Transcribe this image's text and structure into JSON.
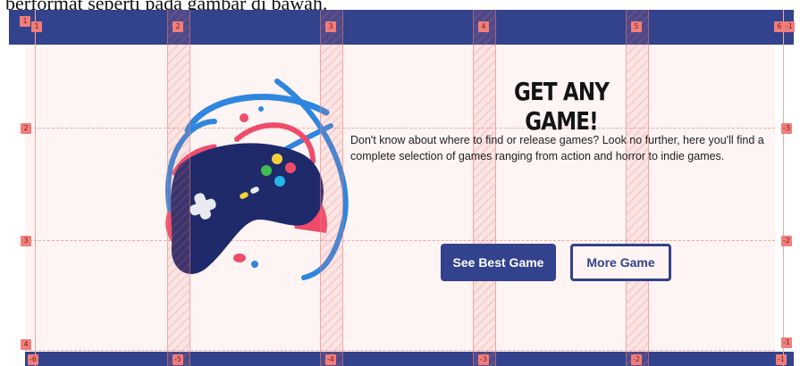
{
  "caption": "berformat seperti pada gambar di bawah.",
  "hero": {
    "title": "GET ANY GAME!",
    "description": "Don't know about where to find or release games? Look no further, here you'll find a complete selection of games ranging from action and horror to indie games.",
    "primary_button": "See Best Game",
    "secondary_button": "More Game"
  },
  "grid": {
    "top_markers": [
      "1",
      "1",
      "2",
      "3",
      "4",
      "5",
      "6",
      "-1"
    ],
    "left_markers": [
      "2",
      "3",
      "4"
    ],
    "right_markers": [
      "-3",
      "-2",
      "-1"
    ],
    "bottom_markers": [
      "-6",
      "-5",
      "-4",
      "-3",
      "-2",
      "-1"
    ]
  },
  "colors": {
    "brand": "#33428c",
    "background": "#fdf4f3",
    "accent_pink": "#f04b6b",
    "accent_blue": "#2e86de",
    "grid": "#f07e7a"
  },
  "icons": {
    "illustration": "gamepad-illustration"
  }
}
